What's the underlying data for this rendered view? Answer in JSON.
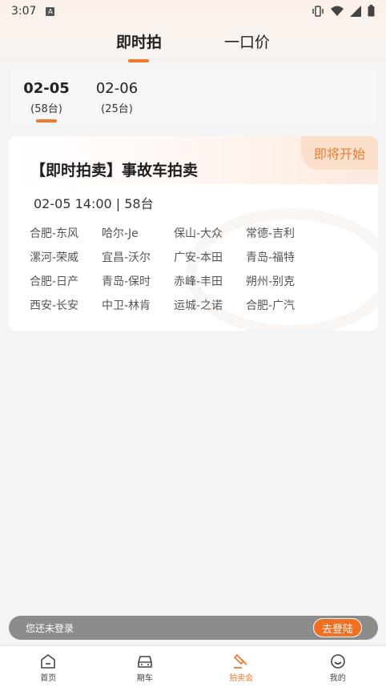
{
  "status": {
    "time": "3:07"
  },
  "top_tabs": [
    {
      "label": "即时拍",
      "active": true
    },
    {
      "label": "一口价",
      "active": false
    }
  ],
  "dates": [
    {
      "date": "02-05",
      "count": "(58台)",
      "active": true
    },
    {
      "date": "02-06",
      "count": "(25台)",
      "active": false
    }
  ],
  "card": {
    "badge": "即将开始",
    "title": "【即时拍卖】事故车拍卖",
    "time": "02-05 14:00 | 58台",
    "tags": [
      "合肥-东风",
      "哈尔-Je",
      "保山-大众",
      "常德-吉利",
      "漯河-荣威",
      "宜昌-沃尔",
      "广安-本田",
      "青岛-福特",
      "合肥-日产",
      "青岛-保时",
      "赤峰-丰田",
      "朔州-别克",
      "西安-长安",
      "中卫-林肯",
      "运城-之诺",
      "合肥-广汽"
    ]
  },
  "login": {
    "text": "您还未登录",
    "button": "去登陆"
  },
  "nav": [
    {
      "label": "首页",
      "icon": "home-icon",
      "active": false
    },
    {
      "label": "期车",
      "icon": "car-icon",
      "active": false
    },
    {
      "label": "拍卖会",
      "icon": "gavel-icon",
      "active": true
    },
    {
      "label": "我的",
      "icon": "smile-icon",
      "active": false
    }
  ],
  "colors": {
    "accent": "#f07a2c",
    "badge_bg": "#fbe0cc",
    "login_bar": "#8c8c8c"
  }
}
